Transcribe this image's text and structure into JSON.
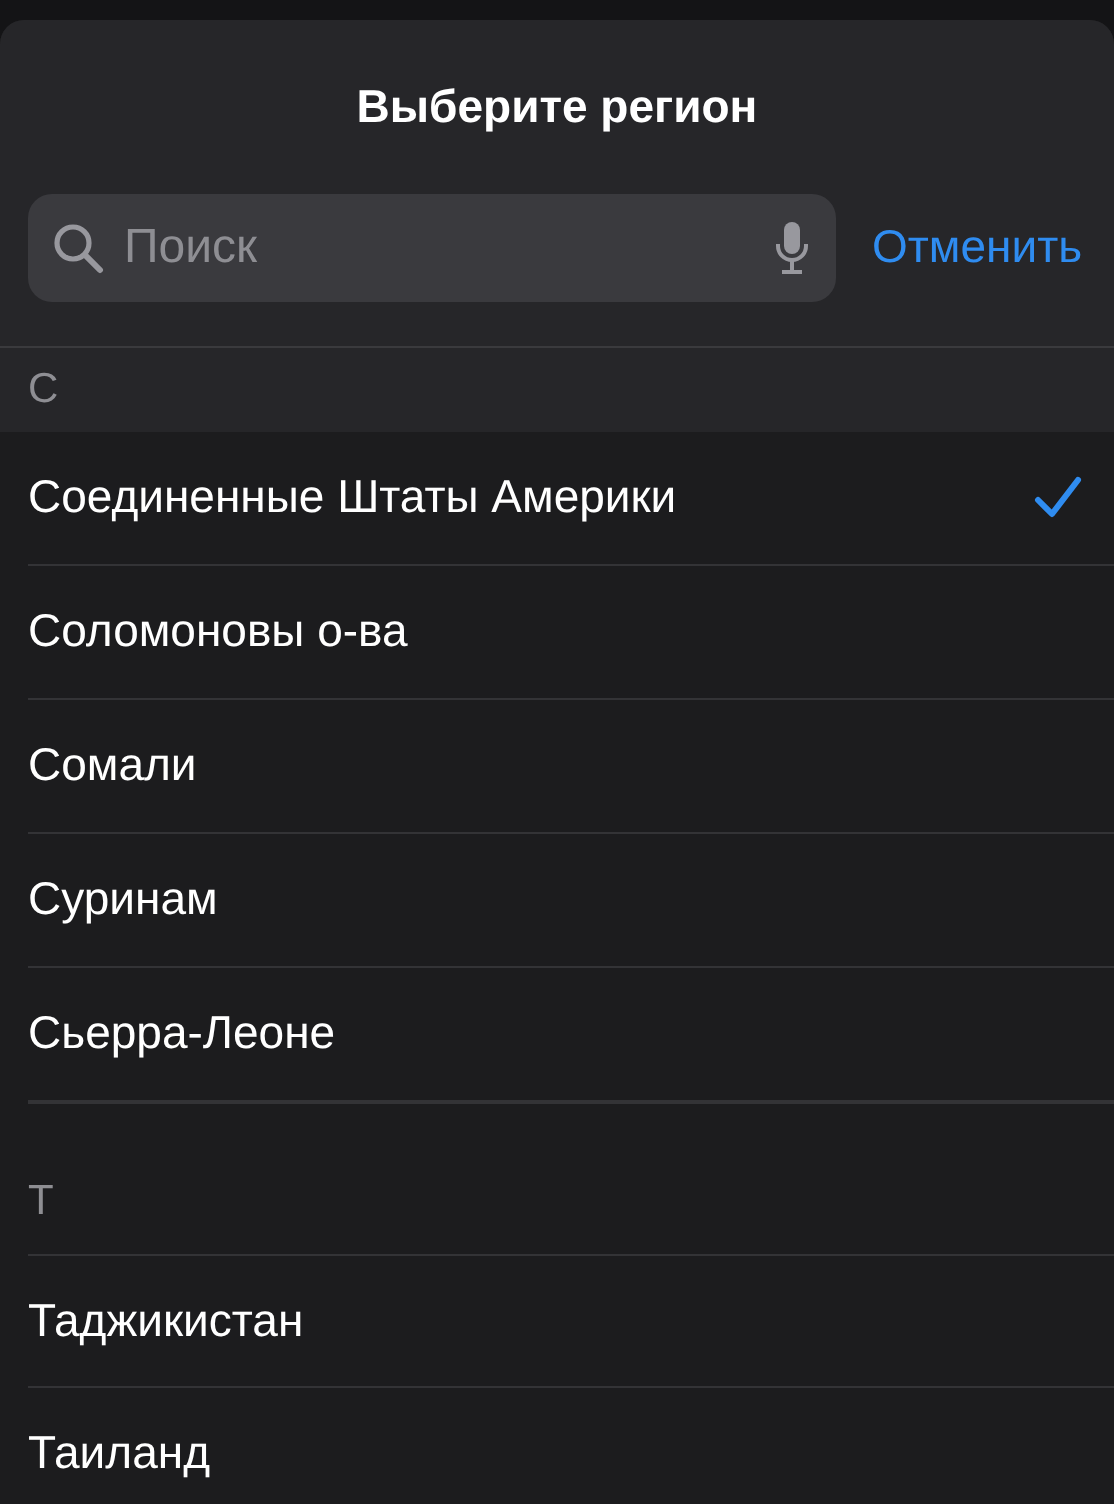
{
  "title": "Выберите регион",
  "search": {
    "placeholder": "Поиск"
  },
  "cancel": "Отменить",
  "sections": [
    {
      "letter": "С",
      "items": [
        {
          "name": "Соединенные Штаты Америки",
          "selected": true
        },
        {
          "name": "Соломоновы о-ва",
          "selected": false
        },
        {
          "name": "Сомали",
          "selected": false
        },
        {
          "name": "Суринам",
          "selected": false
        },
        {
          "name": "Сьерра-Леоне",
          "selected": false
        }
      ]
    },
    {
      "letter": "Т",
      "items": [
        {
          "name": "Таджикистан",
          "selected": false
        },
        {
          "name": "Таиланд",
          "selected": false
        }
      ]
    }
  ]
}
